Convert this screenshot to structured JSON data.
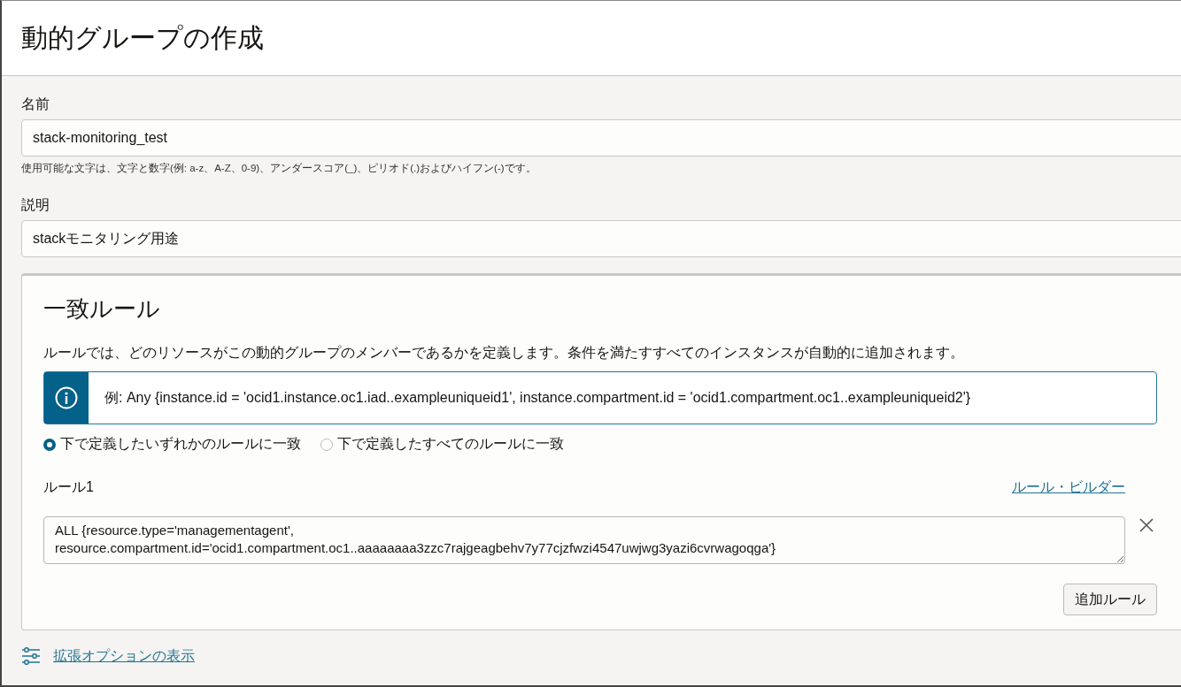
{
  "page": {
    "title": "動的グループの作成"
  },
  "fields": [
    {
      "label": "名前",
      "value": "stack-monitoring_test",
      "hint": "使用可能な文字は、文字と数字(例: a-z、A-Z、0-9)、アンダースコア(_)、ピリオド(.)およびハイフン(-)です。"
    },
    {
      "label": "説明",
      "value": "stackモニタリング用途"
    }
  ],
  "rules_section": {
    "title": "一致ルール",
    "description": "ルールでは、どのリソースがこの動的グループのメンバーであるかを定義します。条件を満たすすべてのインスタンスが自動的に追加されます。",
    "info": "例: Any {instance.id = 'ocid1.instance.oc1.iad..exampleuniqueid1', instance.compartment.id = 'ocid1.compartment.oc1..exampleuniqueid2'}",
    "match_options": [
      {
        "label": "下で定義したいずれかのルールに一致",
        "selected": true
      },
      {
        "label": "下で定義したすべてのルールに一致",
        "selected": false
      }
    ],
    "rules": [
      {
        "label": "ルール1",
        "builder_link": "ルール・ビルダー",
        "value": "ALL {resource.type='managementagent',\nresource.compartment.id='ocid1.compartment.oc1..aaaaaaaa3zzc7rajgeagbehv7y77cjzfwzi4547uwjwg3yazi6cvrwagoqga'}"
      }
    ],
    "add_button": "追加ルール"
  },
  "advanced_link": "拡張オプションの表示"
}
